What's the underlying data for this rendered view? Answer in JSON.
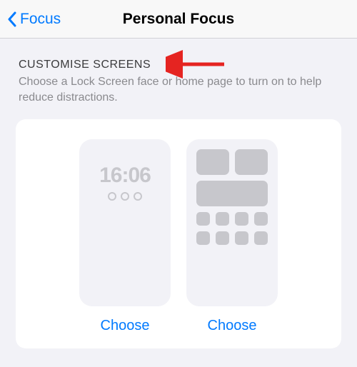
{
  "nav": {
    "back_label": "Focus",
    "title": "Personal Focus"
  },
  "section": {
    "header": "CUSTOMISE SCREENS",
    "subtext": "Choose a Lock Screen face or home page to turn on to help reduce distractions."
  },
  "lockscreen": {
    "time": "16:06",
    "choose_label": "Choose"
  },
  "homescreen": {
    "choose_label": "Choose"
  }
}
